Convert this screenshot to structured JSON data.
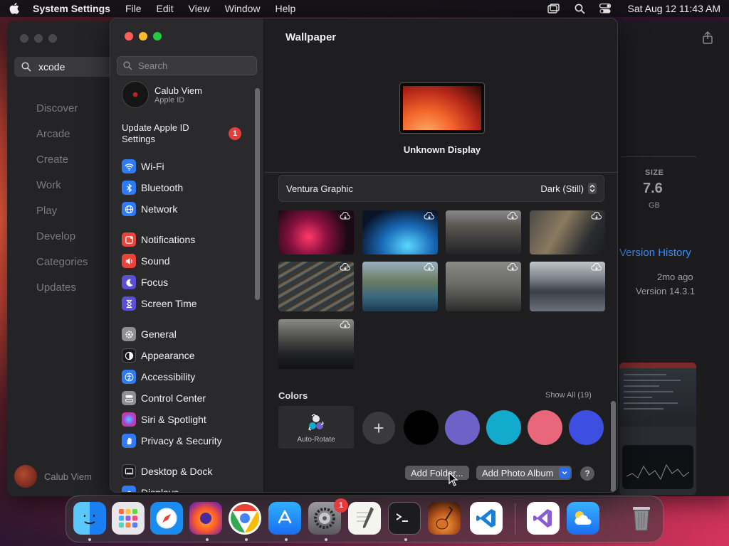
{
  "menubar": {
    "app_name": "System Settings",
    "items": [
      "File",
      "Edit",
      "View",
      "Window",
      "Help"
    ],
    "clock": "Sat Aug 12  11:43 AM"
  },
  "appstore": {
    "search_value": "xcode",
    "nav": [
      "Discover",
      "Arcade",
      "Create",
      "Work",
      "Play",
      "Develop",
      "Categories",
      "Updates"
    ],
    "user_name": "Calub Viem",
    "size_label": "SIZE",
    "size_value": "7.6",
    "size_unit": "GB",
    "version_history": "Version History",
    "updated_ago": "2mo ago",
    "version": "Version 14.3.1"
  },
  "settings": {
    "search_placeholder": "Search",
    "user": {
      "name": "Calub Viem",
      "subtitle": "Apple ID"
    },
    "update_text": "Update Apple ID Settings",
    "update_badge": "1",
    "sidebar_items": [
      {
        "label": "Wi-Fi",
        "icon": "wifi-icon",
        "color": "#2f7bf5"
      },
      {
        "label": "Bluetooth",
        "icon": "bluetooth-icon",
        "color": "#2f7bf5"
      },
      {
        "label": "Network",
        "icon": "globe-icon",
        "color": "#2f7bf5"
      },
      {
        "label": "Notifications",
        "icon": "bell-icon",
        "color": "#e8443a"
      },
      {
        "label": "Sound",
        "icon": "speaker-icon",
        "color": "#e8443a"
      },
      {
        "label": "Focus",
        "icon": "moon-icon",
        "color": "#5a4fd6"
      },
      {
        "label": "Screen Time",
        "icon": "hourglass-icon",
        "color": "#5a4fd6"
      },
      {
        "label": "General",
        "icon": "gear-icon",
        "color": "#8e8e93"
      },
      {
        "label": "Appearance",
        "icon": "appearance-icon",
        "color": "#1c1c1e"
      },
      {
        "label": "Accessibility",
        "icon": "accessibility-icon",
        "color": "#2f7bf5"
      },
      {
        "label": "Control Center",
        "icon": "control-center-icon",
        "color": "#8e8e93"
      },
      {
        "label": "Siri & Spotlight",
        "icon": "siri-icon",
        "color": "#b03ad8"
      },
      {
        "label": "Privacy & Security",
        "icon": "hand-icon",
        "color": "#2f7bf5"
      },
      {
        "label": "Desktop & Dock",
        "icon": "desktop-icon",
        "color": "#1c1c1e"
      },
      {
        "label": "Displays",
        "icon": "display-icon",
        "color": "#2f7bf5"
      }
    ],
    "main": {
      "title": "Wallpaper",
      "display_name": "Unknown Display",
      "wallpaper_name": "Ventura Graphic",
      "wallpaper_mode": "Dark (Still)",
      "colors_title": "Colors",
      "show_all": "Show All (19)",
      "auto_rotate": "Auto-Rotate",
      "swatches": [
        "#000000",
        "#6e62c8",
        "#12aacd",
        "#e8677a",
        "#3d4fe0"
      ],
      "add_folder": "Add Folder...",
      "add_photo_album": "Add Photo Album",
      "help": "?"
    }
  },
  "dock": {
    "apps": [
      "Finder",
      "Launchpad",
      "Safari",
      "Firefox",
      "Chrome",
      "App Store",
      "System Settings",
      "TextEdit",
      "Terminal",
      "Instruments",
      "Visual Studio Code",
      "Visual Studio",
      "Weather",
      "Trash"
    ],
    "settings_badge": "1"
  }
}
